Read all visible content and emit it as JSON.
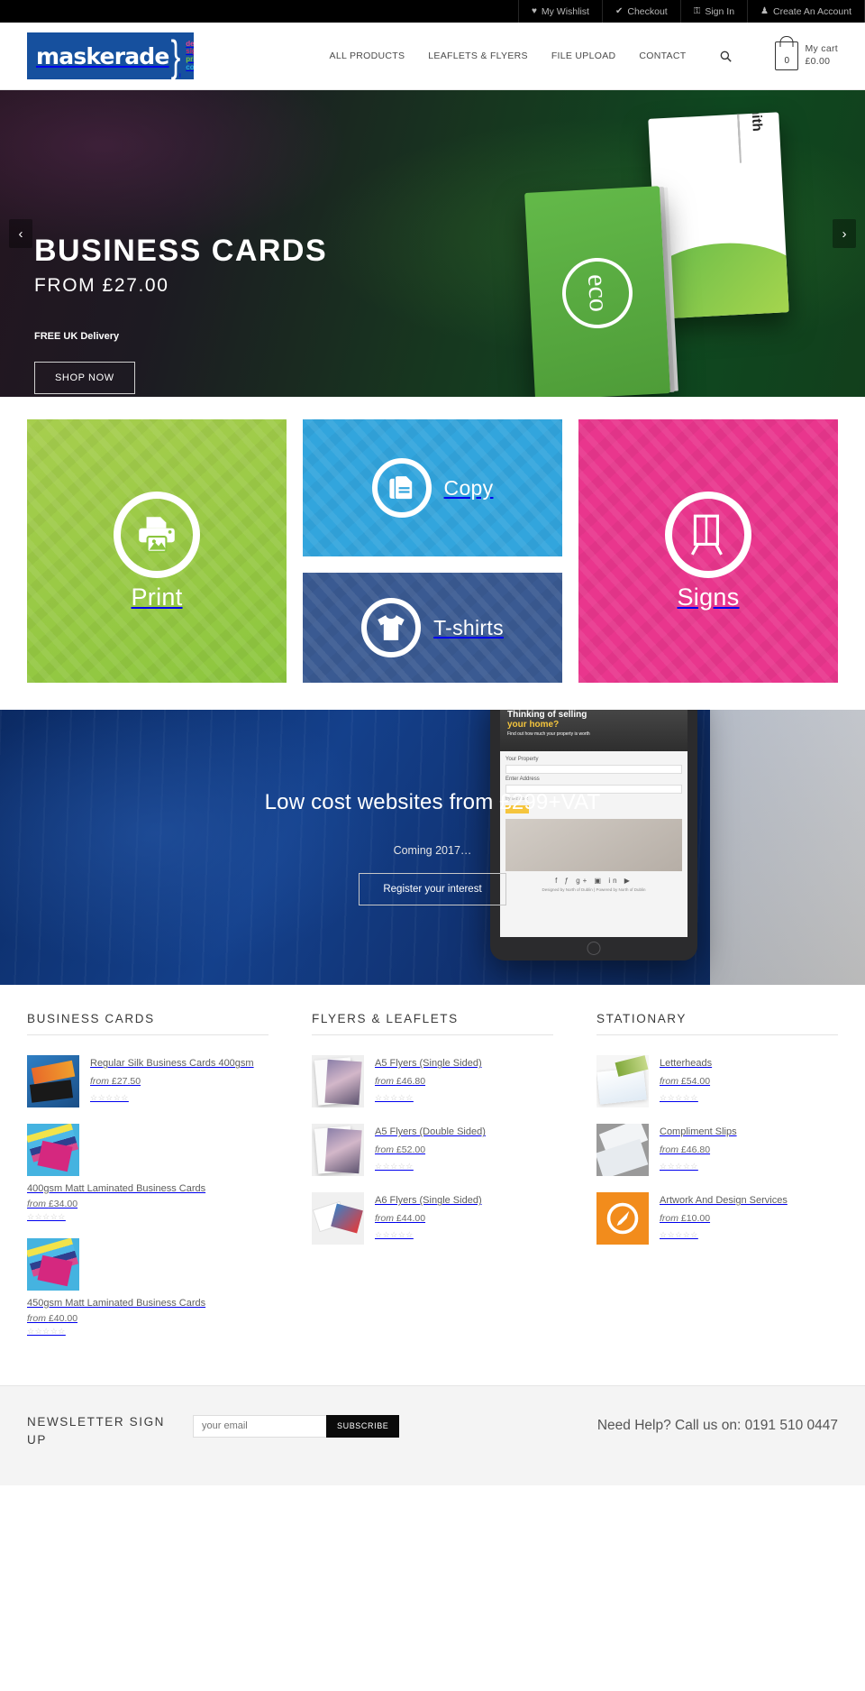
{
  "topbar": {
    "links": [
      {
        "icon": "heart-icon",
        "glyph": "♥",
        "label": "My Wishlist"
      },
      {
        "icon": "check-circle-icon",
        "glyph": "✔",
        "label": "Checkout"
      },
      {
        "icon": "lock-icon",
        "glyph": "⚿",
        "label": "Sign In"
      },
      {
        "icon": "user-icon",
        "glyph": "♟",
        "label": "Create An Account"
      }
    ]
  },
  "header": {
    "logo": {
      "word": "maskerade",
      "brace": "}",
      "tagwords": [
        {
          "text": "design",
          "color": "#e8448f"
        },
        {
          "text": "signs",
          "color": "#d42a6e"
        },
        {
          "text": "print",
          "color": "#7cc242"
        },
        {
          "text": "copy",
          "color": "#27aae1"
        }
      ]
    },
    "nav": [
      {
        "label": "ALL PRODUCTS"
      },
      {
        "label": "LEAFLETS & FLYERS"
      },
      {
        "label": "FILE UPLOAD"
      },
      {
        "label": "CONTACT"
      }
    ],
    "search_icon": "search-icon",
    "cart": {
      "count": "0",
      "title": "My cart",
      "total": "£0.00"
    }
  },
  "hero": {
    "title": "BUSINESS CARDS",
    "subtitle": "FROM £27.00",
    "note": "FREE UK Delivery",
    "button": "SHOP NOW",
    "prev": "‹",
    "next": "›",
    "card_name": "John Smith",
    "card_logo": "eco"
  },
  "tiles": [
    {
      "label": "Print",
      "icon": "printer-icon",
      "color": "#8cc63e"
    },
    {
      "label": "Copy",
      "icon": "document-copy-icon",
      "color": "#32a5dd"
    },
    {
      "label": "T-shirts",
      "icon": "tshirt-icon",
      "color": "#3a5a92"
    },
    {
      "label": "Signs",
      "icon": "a-board-sign-icon",
      "color": "#e9368d"
    }
  ],
  "webband": {
    "title": "Low cost websites from £299+VAT",
    "subtitle": "Coming 2017…",
    "button": "Register your interest",
    "tablet": {
      "headline1": "Thinking of selling",
      "headline2": "your home?",
      "sub": "Find out how much your property is worth",
      "field_label1": "Your Property",
      "field_label2": "Enter Address",
      "field_placeholder": "try a-z / a-z",
      "social": "f  ƒ  g+  ▣  in  ▶",
      "credit": "Designed by North of Dublin | Powered by North of Dublin"
    }
  },
  "product_columns": [
    {
      "title": "BUSINESS CARDS",
      "items": [
        {
          "name": "Regular Silk Business Cards 400gsm",
          "price_prefix": "from",
          "price": "£27.50",
          "stars": "☆☆☆☆☆",
          "thumb": "th-bc1",
          "wrap": false
        },
        {
          "name": "400gsm Matt Laminated Business Cards",
          "price_prefix": "from",
          "price": "£34.00",
          "stars": "☆☆☆☆☆",
          "thumb": "th-bc2",
          "wrap": true
        },
        {
          "name": "450gsm Matt Laminated Business Cards",
          "price_prefix": "from",
          "price": "£40.00",
          "stars": "☆☆☆☆☆",
          "thumb": "th-bc2",
          "wrap": true
        }
      ]
    },
    {
      "title": "FLYERS & LEAFLETS",
      "items": [
        {
          "name": "A5 Flyers (Single Sided)",
          "price_prefix": "from",
          "price": "£46.80",
          "stars": "☆☆☆☆☆",
          "thumb": "th-fly",
          "wrap": false
        },
        {
          "name": "A5 Flyers (Double Sided)",
          "price_prefix": "from",
          "price": "£52.00",
          "stars": "☆☆☆☆☆",
          "thumb": "th-fly",
          "wrap": false
        },
        {
          "name": "A6 Flyers (Single Sided)",
          "price_prefix": "from",
          "price": "£44.00",
          "stars": "☆☆☆☆☆",
          "thumb": "th-fly6",
          "wrap": false
        }
      ]
    },
    {
      "title": "STATIONARY",
      "items": [
        {
          "name": "Letterheads",
          "price_prefix": "from",
          "price": "£54.00",
          "stars": "☆☆☆☆☆",
          "thumb": "th-lh",
          "wrap": false
        },
        {
          "name": "Compliment Slips",
          "price_prefix": "from",
          "price": "£46.80",
          "stars": "☆☆☆☆☆",
          "thumb": "th-cs",
          "wrap": false
        },
        {
          "name": "Artwork And Design Services",
          "price_prefix": "from",
          "price": "£10.00",
          "stars": "☆☆☆☆☆",
          "thumb": "th-art",
          "wrap": false
        }
      ]
    }
  ],
  "footer": {
    "newsletter_title": "NEWSLETTER SIGN UP",
    "email_placeholder": "your email",
    "email_value": "",
    "subscribe_label": "SUBSCRIBE",
    "help_text": "Need Help? Call us on: 0191 510 0447"
  }
}
